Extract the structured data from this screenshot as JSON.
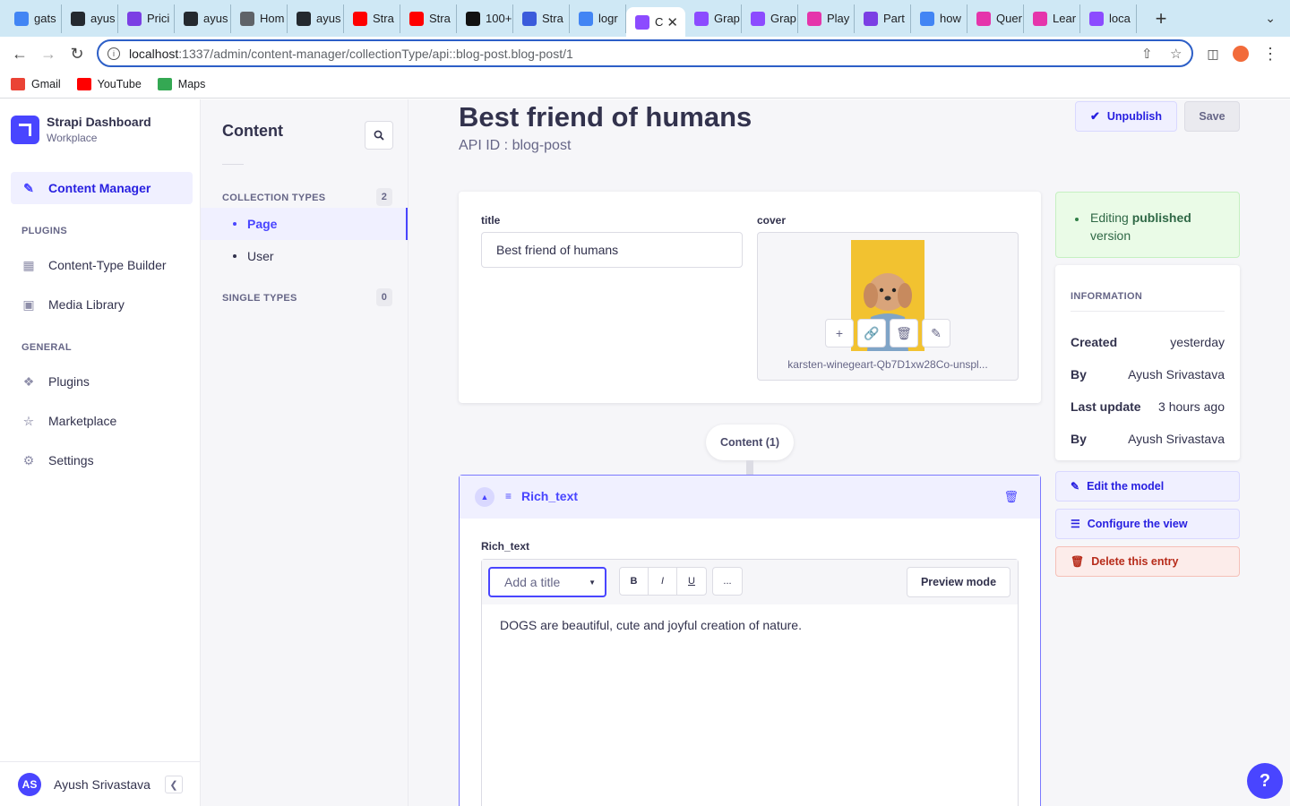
{
  "browser": {
    "tabs": [
      {
        "label": "gats",
        "icon": "google-icon",
        "color": "#4285f4"
      },
      {
        "label": "ayus",
        "icon": "github-icon",
        "color": "#24292f"
      },
      {
        "label": "Prici",
        "icon": "pricing-icon",
        "color": "#7b3fe4"
      },
      {
        "label": "ayus",
        "icon": "github-icon",
        "color": "#24292f"
      },
      {
        "label": "Hom",
        "icon": "globe-icon",
        "color": "#5f6368"
      },
      {
        "label": "ayus",
        "icon": "github-icon",
        "color": "#24292f"
      },
      {
        "label": "Stra",
        "icon": "youtube-icon",
        "color": "#ff0000"
      },
      {
        "label": "Stra",
        "icon": "youtube-icon",
        "color": "#ff0000"
      },
      {
        "label": "100+",
        "icon": "unsplash-icon",
        "color": "#111111"
      },
      {
        "label": "Stra",
        "icon": "infinity-icon",
        "color": "#3b5bdb"
      },
      {
        "label": "logr",
        "icon": "google-icon",
        "color": "#4285f4"
      },
      {
        "label": "C",
        "icon": "strapi-icon",
        "color": "#8c4bff",
        "active": true
      },
      {
        "label": "Grap",
        "icon": "strapi-icon",
        "color": "#8c4bff"
      },
      {
        "label": "Grap",
        "icon": "strapi-icon",
        "color": "#8c4bff"
      },
      {
        "label": "Play",
        "icon": "graphql-icon",
        "color": "#e535ab"
      },
      {
        "label": "Part",
        "icon": "pricing-icon",
        "color": "#7b3fe4"
      },
      {
        "label": "how",
        "icon": "google-icon",
        "color": "#4285f4"
      },
      {
        "label": "Quer",
        "icon": "graphql-outline-icon",
        "color": "#e535ab"
      },
      {
        "label": "Lear",
        "icon": "graphql-outline-icon",
        "color": "#e535ab"
      },
      {
        "label": "loca",
        "icon": "strapi-icon",
        "color": "#8c4bff"
      }
    ],
    "url_host": "localhost",
    "url_path": ":1337/admin/content-manager/collectionType/api::blog-post.blog-post/1",
    "bookmarks": [
      {
        "label": "Gmail",
        "icon": "gmail-icon",
        "color": "#ea4335"
      },
      {
        "label": "YouTube",
        "icon": "youtube-icon",
        "color": "#ff0000"
      },
      {
        "label": "Maps",
        "icon": "maps-icon",
        "color": "#34a853"
      }
    ]
  },
  "sidenav": {
    "brand_title": "Strapi Dashboard",
    "brand_subtitle": "Workplace",
    "content_manager": "Content Manager",
    "plugins_heading": "PLUGINS",
    "content_type_builder": "Content-Type Builder",
    "media_library": "Media Library",
    "general_heading": "GENERAL",
    "plugins": "Plugins",
    "marketplace": "Marketplace",
    "settings": "Settings",
    "user_initials": "AS",
    "user_name": "Ayush Srivastava"
  },
  "subnav": {
    "title": "Content",
    "collection_heading": "COLLECTION TYPES",
    "collection_count": "2",
    "page": "Page",
    "user": "User",
    "single_heading": "SINGLE TYPES",
    "single_count": "0"
  },
  "entry": {
    "title": "Best friend of humans",
    "api_id": "API ID : blog-post",
    "unpublish": "Unpublish",
    "save": "Save",
    "title_label": "title",
    "title_value": "Best friend of humans",
    "cover_label": "cover",
    "cover_filename": "karsten-winegeart-Qb7D1xw28Co-unspl..."
  },
  "dynamic_zone": {
    "pill": "Content (1)",
    "component_name": "Rich_text",
    "field_label": "Rich_text",
    "heading_placeholder": "Add a title",
    "bold": "B",
    "italic": "I",
    "underline": "U",
    "more": "...",
    "preview": "Preview mode",
    "text": "DOGS are beautiful, cute and joyful creation of nature."
  },
  "sidebar": {
    "banner_prefix": "Editing ",
    "banner_bold": "published",
    "banner_suffix": "version",
    "info_heading": "INFORMATION",
    "created_label": "Created",
    "created_value": "yesterday",
    "by_label": "By",
    "created_by": "Ayush Srivastava",
    "updated_label": "Last update",
    "updated_value": "3 hours ago",
    "updated_by_label": "By",
    "updated_by": "Ayush Srivastava",
    "edit_model": "Edit the model",
    "configure_view": "Configure the view",
    "delete_entry": "Delete this entry"
  },
  "help": "?",
  "colors": {
    "primary": "#4945ff",
    "success_bg": "#eafbe7",
    "danger": "#b72b1a"
  }
}
